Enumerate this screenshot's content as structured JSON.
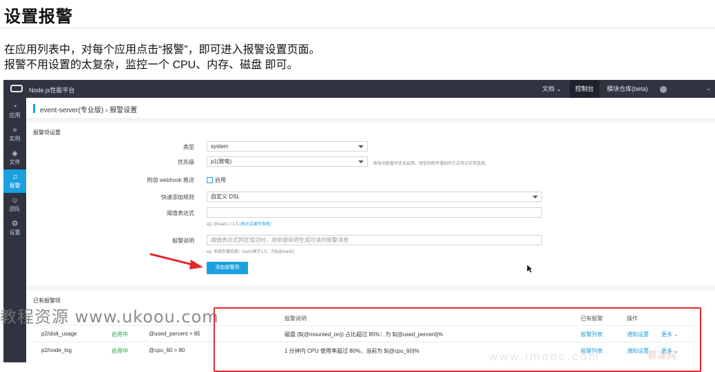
{
  "slide": {
    "title": "设置报警",
    "line1": "在应用列表中，对每个应用点击“报警”，即可进入报警设置页面。",
    "line2": "报警不用设置的太复杂，监控一个 CPU、内存、磁盘 即可。"
  },
  "topbar": {
    "app_title": "Node.js性能平台",
    "docs": "文档",
    "console": "控制台",
    "modules": "模块仓库(beta)"
  },
  "sidebar": {
    "items": [
      {
        "label": "应用",
        "icon": "gauge-icon",
        "glyph": "◔"
      },
      {
        "label": "实例",
        "icon": "chevrons-icon",
        "glyph": "»"
      },
      {
        "label": "文件",
        "icon": "layers-icon",
        "glyph": "◈"
      },
      {
        "label": "报警",
        "icon": "bell-icon",
        "glyph": "♫"
      },
      {
        "label": "团队",
        "icon": "team-icon",
        "glyph": "☺"
      },
      {
        "label": "设置",
        "icon": "gear-icon",
        "glyph": "⚙"
      }
    ],
    "active_index": 3
  },
  "breadcrumb": "event-server(专业版) › 报警设置",
  "form": {
    "section_title": "报警项设置",
    "type_label": "类型",
    "type_value": "system",
    "priority_label": "优先级",
    "priority_value": "p1(致电)",
    "priority_hint": "致电功能暂时还未启用，短信和邮件通知的方式可以正常选用。",
    "webhook_label": "附加 webhook 推送",
    "webhook_option": "启用",
    "rule_label": "快速添加规则",
    "rule_value": "自定义 DSL",
    "threshold_label": "阈值表达式",
    "threshold_hint_prefix": "eg: @load1 > 1.5",
    "threshold_hint_link": "(表达式编写指南)",
    "desc_label": "报警说明",
    "desc_placeholder": "阈值表达式判定成功时，将依据说明生成可读的报警消息",
    "desc_hint": "eg: 系统负载较高：load1高于1.5，为${@load1}",
    "add_button": "添加报警项"
  },
  "existing": {
    "title": "已有报警项",
    "headers": {
      "desc": "报警说明",
      "alerts": "已有报警",
      "ops": "操作"
    },
    "rows": [
      {
        "name": "p2/disk_usage",
        "status": "启用中",
        "expr": "@used_percent > 85",
        "desc": "磁盘 (${@mounted_on}) 占比超过 85%：为 ${@used_percent}%",
        "alerts": "报警列表",
        "notify": "通知设置",
        "more": "更多 ⌄"
      },
      {
        "name": "p2/node_log",
        "status": "启用中",
        "expr": "@cpu_60 > 80",
        "desc": "1 分钟内 CPU 使用率超过 80%，当前为 ${@cpu_60}%",
        "alerts": "报警列表",
        "notify": "通知设置",
        "more": "更多 ⌄"
      }
    ]
  },
  "watermark": "教程资源 www.ukoou.com",
  "watermark2": "www.imooc.com",
  "watermark3": "慕课网",
  "colors": {
    "accent": "#1aa0e0",
    "topbar": "#2f3440",
    "highlight": "#e2262a",
    "status_green": "#29a74a"
  }
}
